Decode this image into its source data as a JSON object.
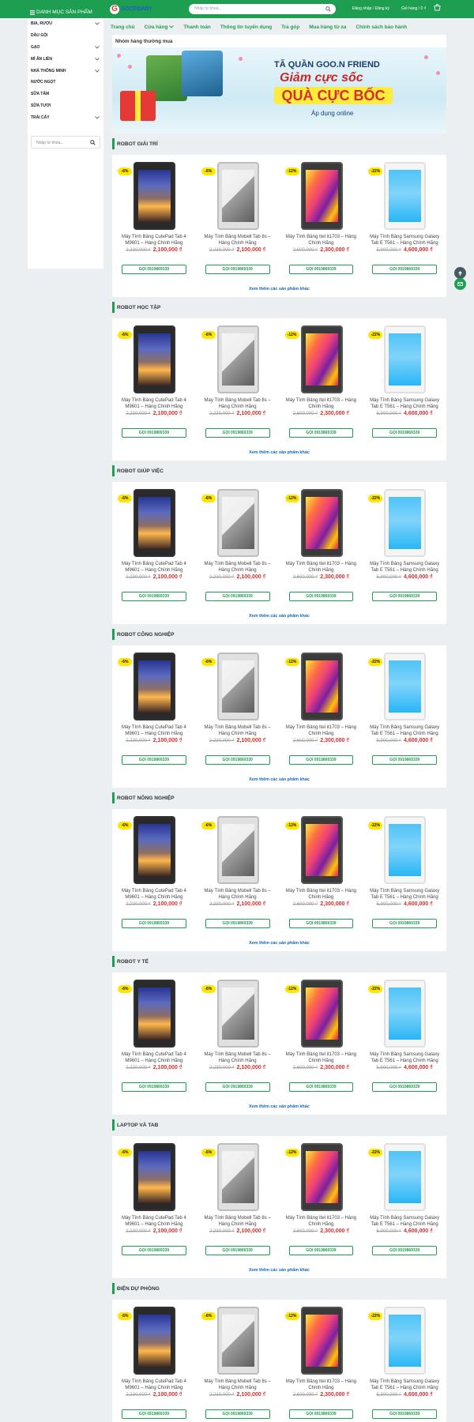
{
  "header": {
    "logo_letter": "G",
    "logo_text": "GOODBABY",
    "search_placeholder": "Nhập từ khoá...",
    "login": "Đăng nhập / Đăng ký",
    "cart": "Giỏ hàng / 0 ₫",
    "brand_color": "#1e9e50"
  },
  "sidebar": {
    "title": "DANH MỤC SẢN PHẨM",
    "items": [
      {
        "label": "BIA, RƯỢU",
        "has_children": true
      },
      {
        "label": "DẦU GỘI",
        "has_children": false
      },
      {
        "label": "GẠO",
        "has_children": true
      },
      {
        "label": "MÌ ĂN LIỀN",
        "has_children": true
      },
      {
        "label": "NHÀ THÔNG MINH",
        "has_children": true
      },
      {
        "label": "NƯỚC NGỌT",
        "has_children": false
      },
      {
        "label": "SỮA TẮM",
        "has_children": false
      },
      {
        "label": "SỮA TƯƠI",
        "has_children": false
      },
      {
        "label": "TRÁI CÂY",
        "has_children": true
      }
    ],
    "search_placeholder": "Nhập từ khóa..."
  },
  "nav": [
    {
      "label": "Trang chủ"
    },
    {
      "label": "Cửa hàng",
      "dropdown": true
    },
    {
      "label": "Thanh toán"
    },
    {
      "label": "Thông tin tuyển dụng"
    },
    {
      "label": "Trả góp"
    },
    {
      "label": "Mua hàng từ xa"
    },
    {
      "label": "Chính sách bảo hành"
    }
  ],
  "banner": {
    "group_title": "Nhóm hàng thường mua",
    "line1": "TÃ QUẦN GOO.N FRIEND",
    "line2": "Giảm cực sốc",
    "line3": "QUÀ CỰC BỐC",
    "line4": "Áp dụng online"
  },
  "call_label": "GỌI 0919869339",
  "more_label": "Xem thêm các sản phẩm khác",
  "products": [
    {
      "discount": "-6%",
      "name": "Máy Tính Bảng CutePad Tab 4 M9601 – Hàng Chính Hãng",
      "old_price": "2,230,000 ₫",
      "new_price": "2,100,000 ₫",
      "theme": "t1"
    },
    {
      "discount": "-6%",
      "name": "Máy Tính Bảng Mobell Tab 8s – Hàng Chính Hãng",
      "old_price": "2,230,000 ₫",
      "new_price": "2,100,000 ₫",
      "theme": "t2"
    },
    {
      "discount": "-12%",
      "name": "Máy Tính Bảng Itel it1703 – Hàng Chính Hãng",
      "old_price": "2,600,000 ₫",
      "new_price": "2,300,000 ₫",
      "theme": "t3"
    },
    {
      "discount": "-22%",
      "name": "Máy Tính Bảng Samsung Galaxy Tab E T561 – Hàng Chính Hãng",
      "old_price": "5,900,000 ₫",
      "new_price": "4,600,000 ₫",
      "theme": "t4"
    }
  ],
  "sections": [
    "ROBOT GIẢI TRÍ",
    "ROBOT HỌC TẬP",
    "ROBOT GIÚP VIỆC",
    "ROBOT CÔNG NGHIỆP",
    "ROBOT NÔNG NGHIỆP",
    "ROBOT Y TẾ",
    "LAPTOP VÀ TAB",
    "ĐIỆN DỰ PHÒNG"
  ],
  "floating": {
    "message_label": "Liên hệ"
  }
}
